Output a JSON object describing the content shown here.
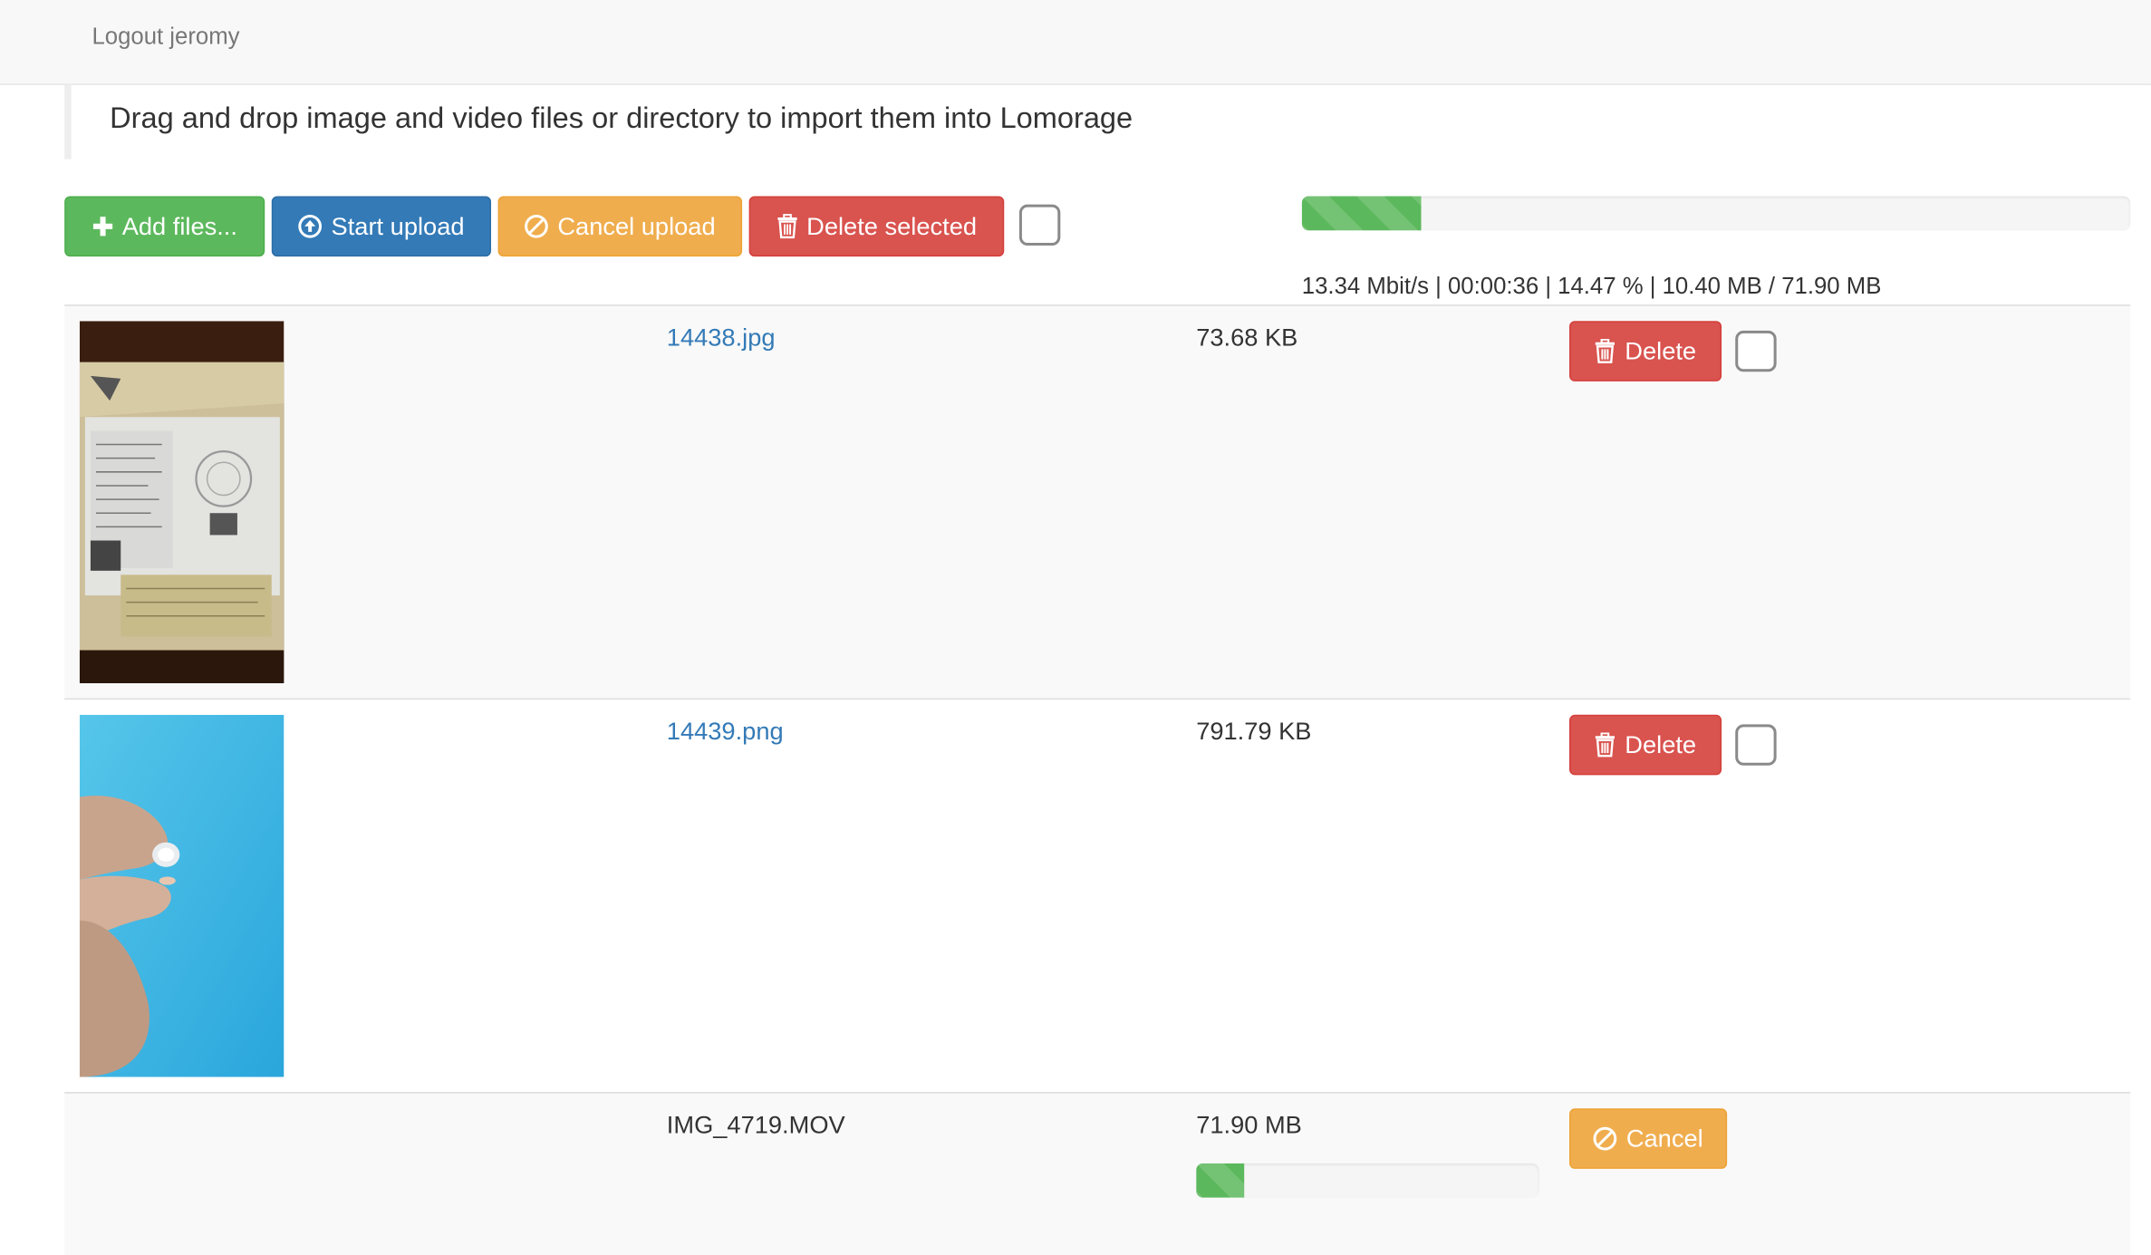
{
  "topbar": {
    "logout_label": "Logout jeromy"
  },
  "notice": {
    "text": "Drag and drop image and video files or directory to import them into Lomorage"
  },
  "toolbar": {
    "add_files_label": "Add files...",
    "start_upload_label": "Start upload",
    "cancel_upload_label": "Cancel upload",
    "delete_selected_label": "Delete selected",
    "select_all_checked": false
  },
  "global_progress": {
    "percent": 14.47,
    "extended_text": "13.34 Mbit/s | 00:00:36 | 14.47 % | 10.40 MB / 71.90 MB"
  },
  "files": [
    {
      "name": "14438.jpg",
      "size": "73.68 KB",
      "action_label": "Delete",
      "thumbnail": "certificate-photo",
      "checked": false
    },
    {
      "name": "14439.png",
      "size": "791.79 KB",
      "action_label": "Delete",
      "thumbnail": "diamond-in-fingers-photo",
      "checked": false
    },
    {
      "name": "IMG_4719.MOV",
      "size": "71.90 MB",
      "action_label": "Cancel",
      "progress_percent": 14
    }
  ],
  "colors": {
    "success": "#5cb85c",
    "primary": "#337ab7",
    "warning": "#f0ad4e",
    "danger": "#d9534f",
    "link": "#337ab7"
  }
}
